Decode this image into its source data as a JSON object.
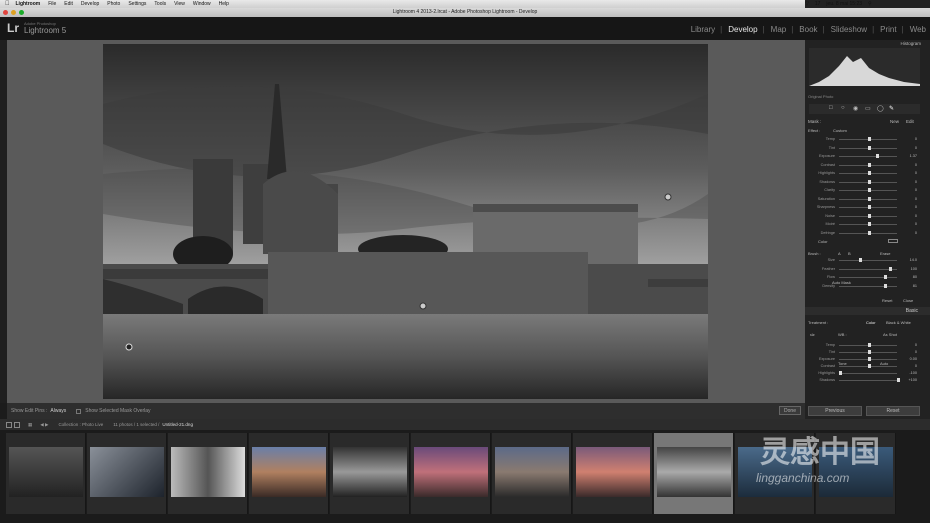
{
  "menubar": {
    "app": "Lightroom",
    "items": [
      "File",
      "Edit",
      "Develop",
      "Photo",
      "Settings",
      "Tools",
      "View",
      "Window",
      "Help"
    ],
    "status": [
      "17",
      "jeu. 8 mai 15:23"
    ]
  },
  "window": {
    "title": "Lightroom 4 2013-2.lrcat - Adobe Photoshop Lightroom - Develop"
  },
  "brand": {
    "logo": "Lr",
    "sub": "Adobe Photoshop",
    "name": "Lightroom 5"
  },
  "modules": [
    "Library",
    "Develop",
    "Map",
    "Book",
    "Slideshow",
    "Print",
    "Web"
  ],
  "active_module": "Develop",
  "right_panel": {
    "histogram_label": "Histogram",
    "original_photo": "Original Photo",
    "mask_label": "Mask :",
    "mask_new": "New",
    "mask_edit": "Edit",
    "effect_label": "Effect :",
    "effect_value": "Custom",
    "sliders": [
      {
        "label": "Temp",
        "val": "0"
      },
      {
        "label": "Tint",
        "val": "0"
      },
      {
        "label": "Exposure",
        "val": "1.37"
      },
      {
        "label": "Contrast",
        "val": "0"
      },
      {
        "label": "Highlights",
        "val": "0"
      },
      {
        "label": "Shadows",
        "val": "0"
      },
      {
        "label": "Clarity",
        "val": "0"
      },
      {
        "label": "Saturation",
        "val": "0"
      },
      {
        "label": "Sharpness",
        "val": "0"
      },
      {
        "label": "Noise",
        "val": "0"
      },
      {
        "label": "Moiré",
        "val": "0"
      },
      {
        "label": "Defringe",
        "val": "0"
      }
    ],
    "color_label": "Color",
    "brush_label": "Brush :",
    "brush_a": "A",
    "brush_b": "B",
    "brush_erase": "Erase",
    "brush_sliders": [
      {
        "label": "Size",
        "val": "14.0"
      },
      {
        "label": "Feather",
        "val": "100"
      },
      {
        "label": "Flow",
        "val": "80"
      },
      {
        "label": "Density",
        "val": "81"
      }
    ],
    "auto_mask": "Auto Mask",
    "reset": "Reset",
    "close": "Close",
    "basic_label": "Basic",
    "treatment_label": "Treatment :",
    "treatment_color": "Color",
    "treatment_bw": "Black & White",
    "wb_label": "WB :",
    "wb_value": "As Shot",
    "basic_sliders": [
      {
        "label": "Temp",
        "val": "0"
      },
      {
        "label": "Tint",
        "val": "0"
      },
      {
        "label": "Exposure",
        "val": "0.00"
      },
      {
        "label": "Contrast",
        "val": "0"
      },
      {
        "label": "Highlights",
        "val": "-100"
      },
      {
        "label": "Shadows",
        "val": "+100"
      }
    ],
    "tone_label": "Tone",
    "tone_auto": "Auto"
  },
  "toolbar": {
    "show_edit_pins_label": "Show Edit Pins :",
    "show_edit_pins_value": "Always",
    "overlay_label": "Show Selected Mask Overlay",
    "done": "Done"
  },
  "buttons": {
    "previous": "Previous",
    "reset": "Reset"
  },
  "filmbar": {
    "source": "Collection : Photo Live",
    "count": "11 photos / 1 selected /",
    "file": "Untitled-21.dng"
  },
  "watermark": {
    "text": "灵感中国",
    "url": "lingganchina.com"
  }
}
